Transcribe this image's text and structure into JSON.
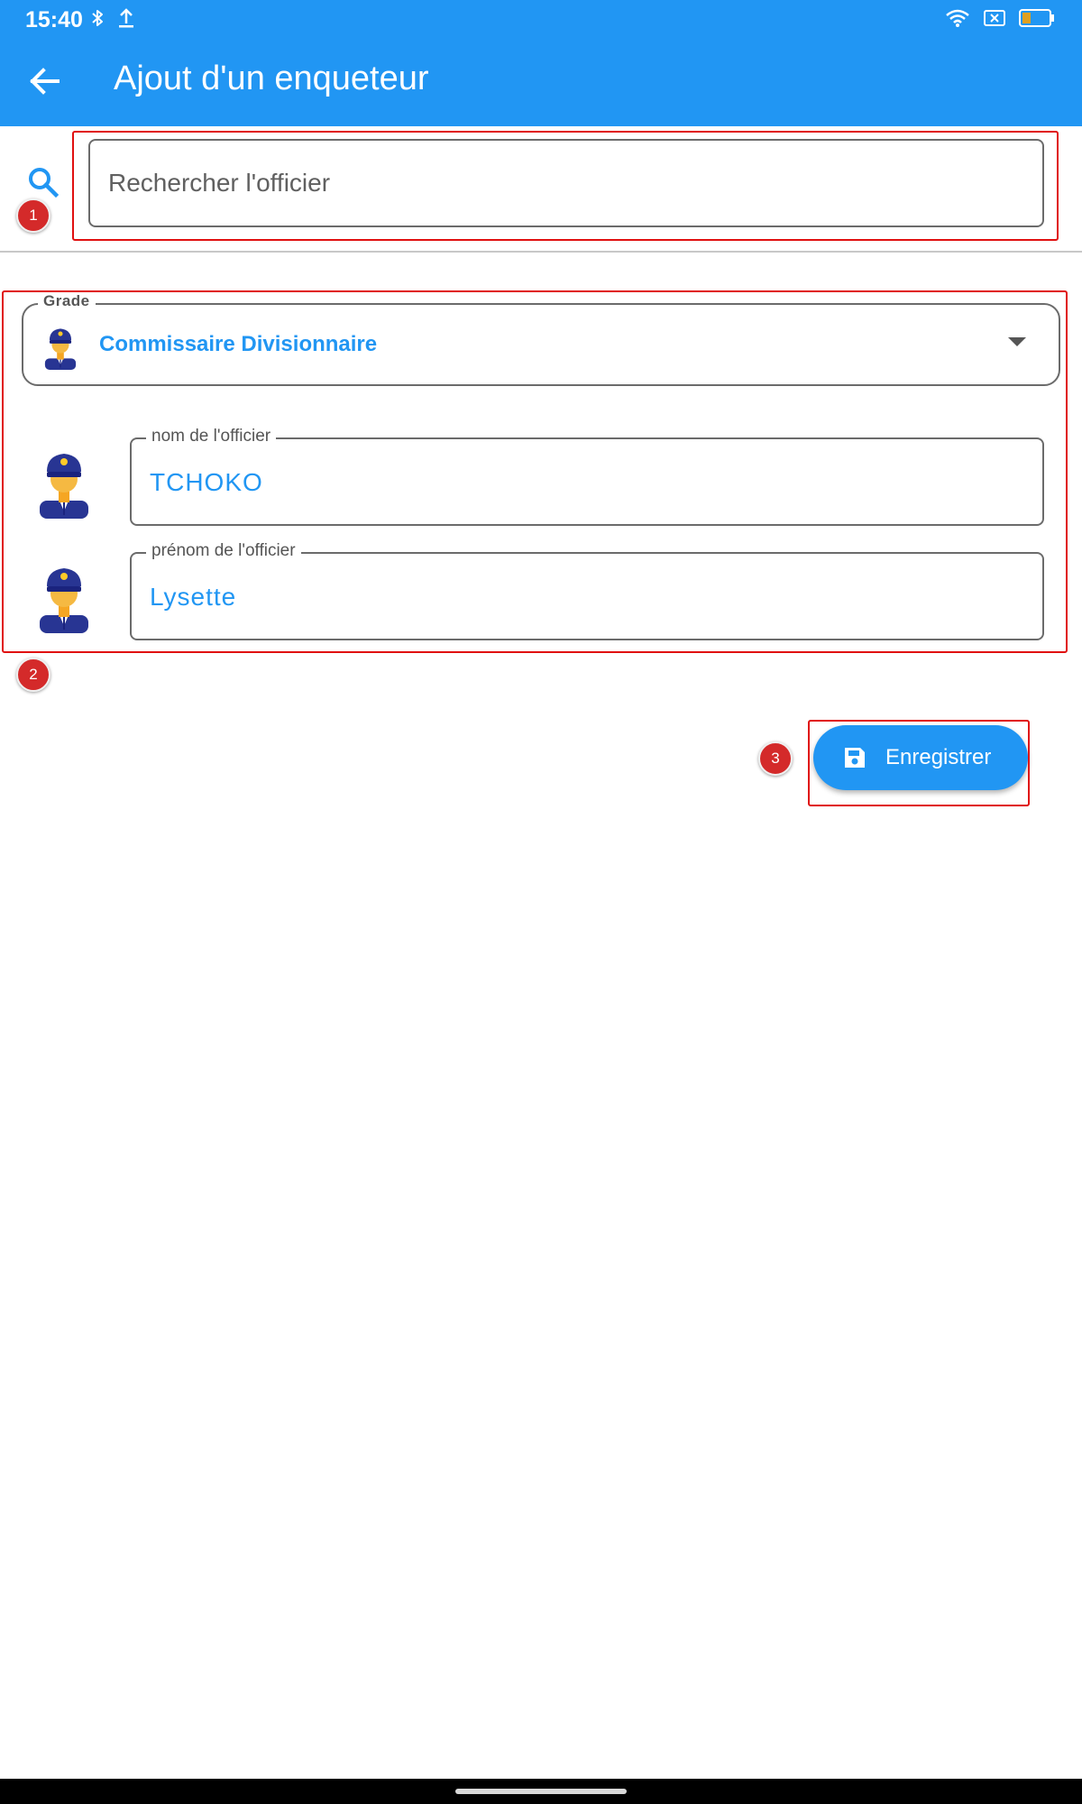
{
  "status_bar": {
    "time": "15:40",
    "left_icons": [
      "bluetooth-icon",
      "upload-icon"
    ],
    "right_icons": [
      "wifi-icon",
      "sim-off-icon",
      "battery-icon"
    ]
  },
  "app_bar": {
    "title": "Ajout d'un enqueteur",
    "back_icon": "arrow-back-icon"
  },
  "search": {
    "icon": "search-icon",
    "placeholder": "Rechercher l'officier",
    "value": ""
  },
  "form": {
    "grade": {
      "label": "Grade",
      "value": "Commissaire Divisionnaire",
      "avatar_icon": "police-officer-icon"
    },
    "nom": {
      "label": "nom de l'officier",
      "value": "TCHOKO",
      "avatar_icon": "police-officer-icon"
    },
    "prenom": {
      "label": "prénom de l'officier",
      "value": "Lysette",
      "avatar_icon": "police-officer-icon"
    }
  },
  "actions": {
    "save_label": "Enregistrer",
    "save_icon": "save-icon"
  },
  "annotations": [
    {
      "number": "1"
    },
    {
      "number": "2"
    },
    {
      "number": "3"
    }
  ],
  "colors": {
    "primary": "#2196F3",
    "annotation": "#e01010"
  }
}
